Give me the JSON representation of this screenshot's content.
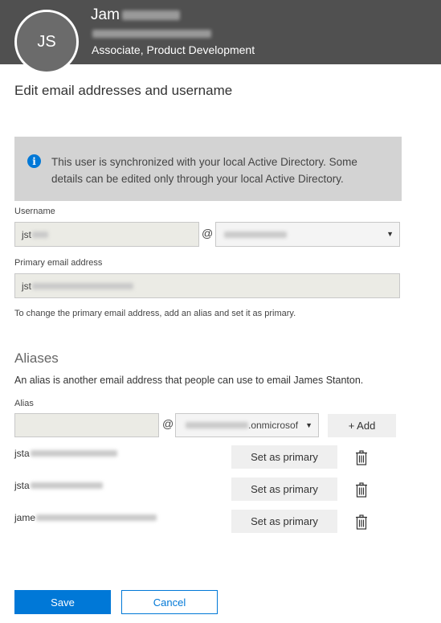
{
  "header": {
    "initials": "JS",
    "name_visible": "Jam",
    "title": "Associate, Product Development"
  },
  "panel": {
    "title": "Edit email addresses and username"
  },
  "info": {
    "message": "This user is synchronized with your local Active Directory. Some details can be edited only through your local Active Directory."
  },
  "username": {
    "label": "Username",
    "value_visible": "jst",
    "at": "@"
  },
  "primary_email": {
    "label": "Primary email address",
    "value_visible": "jst",
    "hint": "To change the primary email address, add an alias and set it as primary."
  },
  "aliases": {
    "title": "Aliases",
    "description": "An alias is another email address that people can use to email James Stanton.",
    "alias_label": "Alias",
    "at": "@",
    "domain_visible": ".onmicrosof",
    "add_label": "+ Add",
    "items": [
      {
        "visible": "jsta",
        "action": "Set as primary"
      },
      {
        "visible": "jsta",
        "action": "Set as primary"
      },
      {
        "visible": "jame",
        "action": "Set as primary"
      }
    ]
  },
  "footer": {
    "save_label": "Save",
    "cancel_label": "Cancel"
  },
  "colors": {
    "accent": "#0078d7",
    "header_bg": "#505050",
    "info_bg": "#d3d3d3"
  }
}
